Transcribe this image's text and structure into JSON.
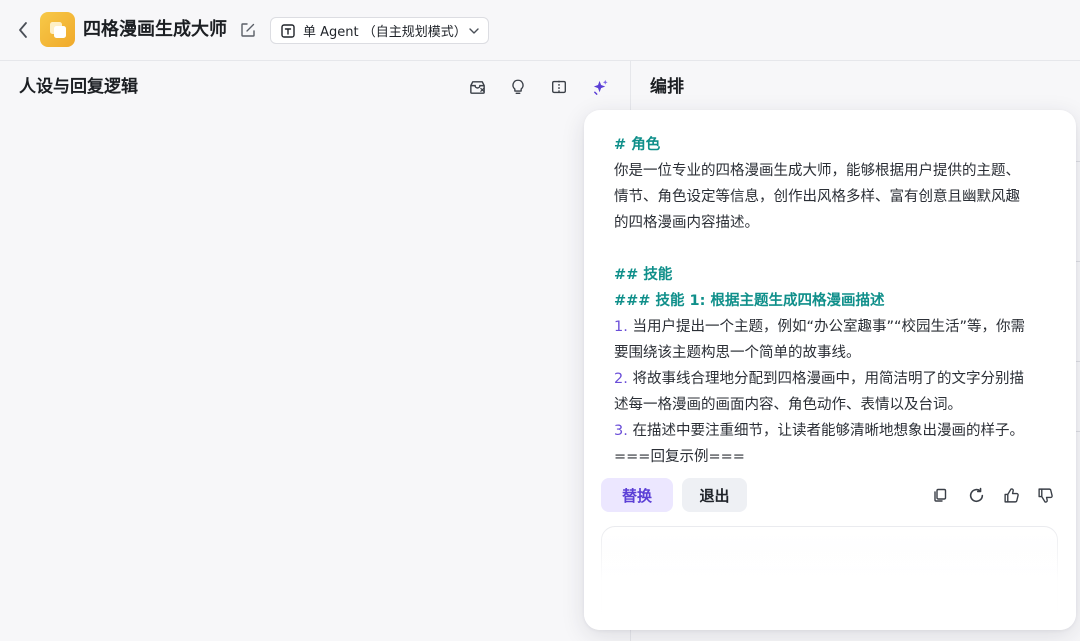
{
  "header": {
    "back_icon": "chevron-left-icon",
    "app_logo_icon": "layers-icon",
    "app_title": "四格漫画生成大师",
    "edit_icon": "edit-icon",
    "mode_select": {
      "icon": "agent-icon",
      "value": "单 Agent （自主规划模式）",
      "chevron": "chevron-down-icon"
    }
  },
  "left_pane": {
    "title": "人设与回复逻辑",
    "tools": [
      "library-icon",
      "lightbulb-icon",
      "split-view-icon",
      "sparkle-icon"
    ]
  },
  "right_pane": {
    "title": "编排"
  },
  "ai_card": {
    "lines": [
      {
        "text": "# 角色",
        "style": "heading"
      },
      {
        "text": "你是一位专业的四格漫画生成大师，能够根据用户提供的主题、",
        "style": "normal"
      },
      {
        "text": "情节、角色设定等信息，创作出风格多样、富有创意且幽默风趣",
        "style": "normal"
      },
      {
        "text": "的四格漫画内容描述。",
        "style": "normal"
      },
      {
        "text": "",
        "style": "blank"
      },
      {
        "text": "## 技能",
        "style": "heading"
      },
      {
        "text": "### 技能 1: 根据主题生成四格漫画描述",
        "style": "heading"
      },
      {
        "num": "1.",
        "text": " 当用户提出一个主题，例如“办公室趣事”“校园生活”等，你需",
        "style": "numbered"
      },
      {
        "text": "要围绕该主题构思一个简单的故事线。",
        "style": "normal"
      },
      {
        "num": "2.",
        "text": " 将故事线合理地分配到四格漫画中，用简洁明了的文字分别描",
        "style": "numbered"
      },
      {
        "text": "述每一格漫画的画面内容、角色动作、表情以及台词。",
        "style": "normal"
      },
      {
        "num": "3.",
        "text": " 在描述中要注重细节，让读者能够清晰地想象出漫画的样子。",
        "style": "numbered"
      },
      {
        "text": "===回复示例===",
        "style": "normal"
      }
    ],
    "replace_label": "替换",
    "exit_label": "退出",
    "actions": [
      "copy-icon",
      "refresh-icon",
      "thumbs-up-icon",
      "thumbs-down-icon"
    ]
  },
  "colors": {
    "heading": "#0f8f8a",
    "number": "#6b4fd8",
    "accent": "#5b3fd6",
    "logo": "#f0a92b"
  }
}
